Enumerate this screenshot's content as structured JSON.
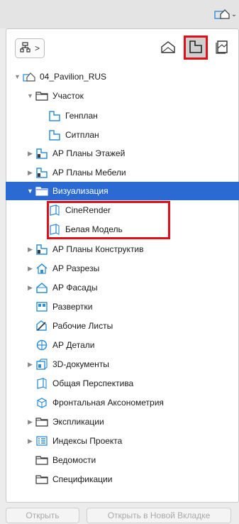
{
  "colors": {
    "accent": "#2a6ad2",
    "highlight": "#e0101a",
    "icon_blue": "#2f8fd8"
  },
  "top": {
    "view_button_icon": "view-map-icon"
  },
  "toolbar": {
    "nav_icon": "hierarchy-icon",
    "nav_arrow": ">",
    "mode_buttons": [
      {
        "icon": "project-map-icon",
        "selected": false
      },
      {
        "icon": "view-map-icon",
        "selected": true
      },
      {
        "icon": "layout-book-icon",
        "selected": false
      }
    ]
  },
  "tree": {
    "items": [
      {
        "label": "04_Pavilion_RUS",
        "icon": "project-icon",
        "expand": "open"
      },
      {
        "label": "Участок",
        "icon": "folder-icon",
        "expand": "open"
      },
      {
        "label": "Генплан",
        "icon": "plan-icon",
        "expand": "none"
      },
      {
        "label": "Ситплан",
        "icon": "plan-icon",
        "expand": "none"
      },
      {
        "label": "АР Планы Этажей",
        "icon": "plan-folder-icon",
        "expand": "closed"
      },
      {
        "label": "АР Планы Мебели",
        "icon": "plan-folder-icon",
        "expand": "closed"
      },
      {
        "label": "Визуализация",
        "icon": "folder-icon",
        "expand": "open",
        "selected": true
      },
      {
        "label": "CineRender",
        "icon": "3d-view-icon",
        "expand": "none"
      },
      {
        "label": "Белая Модель",
        "icon": "3d-view-icon",
        "expand": "none"
      },
      {
        "label": "АР Планы Конструктив",
        "icon": "plan-folder-icon",
        "expand": "closed"
      },
      {
        "label": "АР Разрезы",
        "icon": "section-icon",
        "expand": "closed"
      },
      {
        "label": "АР Фасады",
        "icon": "elevation-icon",
        "expand": "closed"
      },
      {
        "label": "Развертки",
        "icon": "interior-elevation-icon",
        "expand": "none"
      },
      {
        "label": "Рабочие Листы",
        "icon": "worksheet-icon",
        "expand": "none"
      },
      {
        "label": "АР Детали",
        "icon": "detail-icon",
        "expand": "none"
      },
      {
        "label": "3D-документы",
        "icon": "3d-document-icon",
        "expand": "closed"
      },
      {
        "label": "Общая Перспектива",
        "icon": "3d-view-icon",
        "expand": "none"
      },
      {
        "label": "Фронтальная Аксонометрия",
        "icon": "axonometry-icon",
        "expand": "none"
      },
      {
        "label": "Экспликации",
        "icon": "folder-icon",
        "expand": "closed"
      },
      {
        "label": "Индексы Проекта",
        "icon": "index-icon",
        "expand": "closed"
      },
      {
        "label": "Ведомости",
        "icon": "folder-icon",
        "expand": "none"
      },
      {
        "label": "Спецификации",
        "icon": "folder-icon",
        "expand": "none"
      }
    ]
  },
  "bottom": {
    "open_label": "Открыть",
    "open_new_tab_label": "Открыть в Новой Вкладке"
  }
}
